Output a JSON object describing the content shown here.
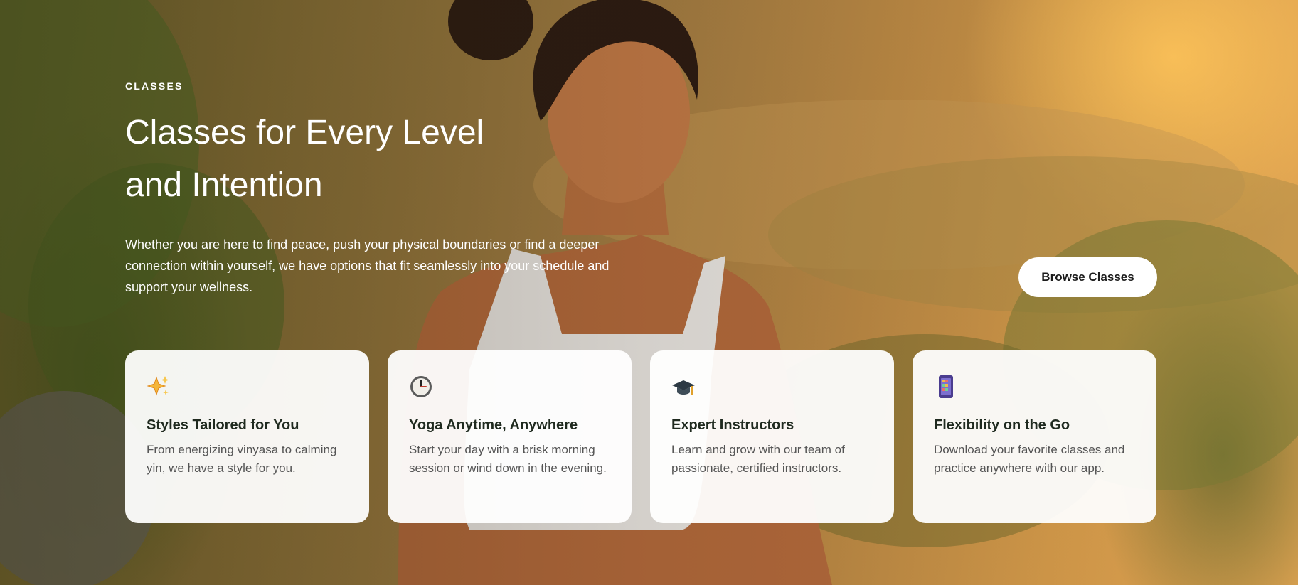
{
  "hero": {
    "eyebrow": "CLASSES",
    "title_line1": "Classes for Every Level",
    "title_line2": "and Intention",
    "description": "Whether you are here to find peace, push your physical boundaries or find a deeper connection within yourself, we have options that fit seamlessly into your schedule and support your wellness.",
    "cta_label": "Browse Classes"
  },
  "features": [
    {
      "icon": "sparkles-icon",
      "title": "Styles Tailored for You",
      "description": "From energizing vinyasa to calming yin, we have a style for you."
    },
    {
      "icon": "clock-icon",
      "title": "Yoga Anytime, Anywhere",
      "description": "Start your day with a brisk morning session or wind down in the evening."
    },
    {
      "icon": "graduation-cap-icon",
      "title": "Expert Instructors",
      "description": "Learn and grow with our team of passionate, certified instructors."
    },
    {
      "icon": "mobile-app-icon",
      "title": "Flexibility on the Go",
      "description": "Download your favorite classes and practice anywhere with our app."
    }
  ]
}
